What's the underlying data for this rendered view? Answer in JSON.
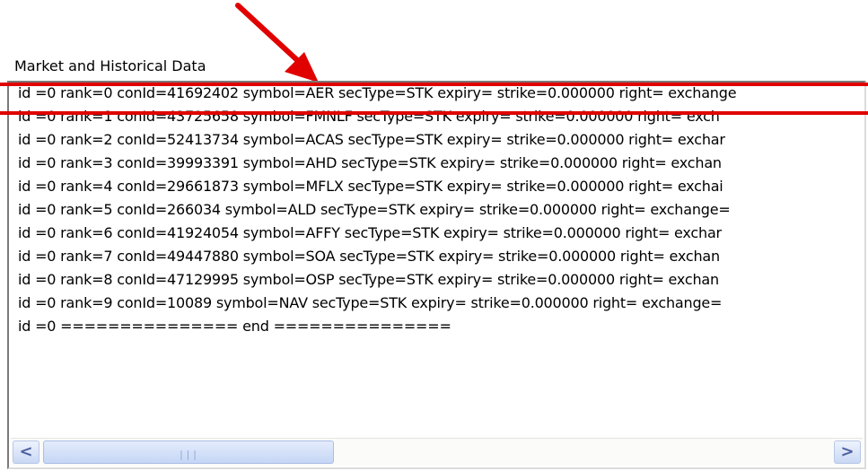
{
  "panel": {
    "title": "Market and Historical Data",
    "lines": [
      "id =0 rank=0 conId=41692402 symbol=AER secType=STK expiry= strike=0.000000 right= exchange",
      "id =0 rank=1 conId=43725658 symbol=FMNLF secType=STK expiry= strike=0.000000 right= exch",
      "id =0 rank=2 conId=52413734 symbol=ACAS secType=STK expiry= strike=0.000000 right= exchar",
      "id =0 rank=3 conId=39993391 symbol=AHD secType=STK expiry= strike=0.000000 right= exchan",
      "id =0 rank=4 conId=29661873 symbol=MFLX secType=STK expiry= strike=0.000000 right= exchai",
      "id =0 rank=5 conId=266034 symbol=ALD secType=STK expiry= strike=0.000000 right= exchange=",
      "id =0 rank=6 conId=41924054 symbol=AFFY secType=STK expiry= strike=0.000000 right= exchar",
      "id =0 rank=7 conId=49447880 symbol=SOA secType=STK expiry= strike=0.000000 right= exchan",
      "id =0 rank=8 conId=47129995 symbol=OSP secType=STK expiry= strike=0.000000 right= exchan",
      "id =0 rank=9 conId=10089 symbol=NAV secType=STK expiry= strike=0.000000 right= exchange=",
      "id =0 =============== end ==============="
    ]
  },
  "scrollbar": {
    "left_arrow": "<",
    "right_arrow": ">",
    "thumb_grip": "|||"
  },
  "annotation": {
    "color": "#e00000"
  }
}
